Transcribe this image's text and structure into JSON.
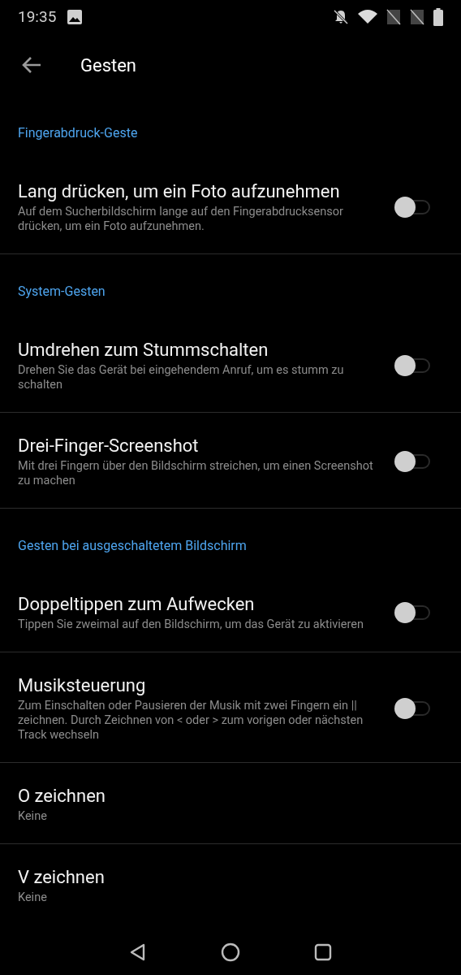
{
  "status_bar": {
    "time": "19:35"
  },
  "toolbar": {
    "title": "Gesten"
  },
  "sections": [
    {
      "heading": "Fingerabdruck-Geste",
      "items": [
        {
          "kind": "toggle",
          "title": "Lang drücken, um ein Foto aufzunehmen",
          "subtitle": "Auf dem Sucherbildschirm lange auf den Fingerabdrucksensor drücken, um ein Foto aufzunehmen.",
          "on": false
        }
      ]
    },
    {
      "heading": "System-Gesten",
      "items": [
        {
          "kind": "toggle",
          "title": "Umdrehen zum Stummschalten",
          "subtitle": "Drehen Sie das Gerät bei eingehendem Anruf, um es stumm zu schalten",
          "on": false
        },
        {
          "kind": "toggle",
          "title": "Drei-Finger-Screenshot",
          "subtitle": "Mit drei Fingern über den Bildschirm streichen, um einen Screenshot zu machen",
          "on": false
        }
      ]
    },
    {
      "heading": "Gesten bei ausgeschaltetem Bildschirm",
      "items": [
        {
          "kind": "toggle",
          "title": "Doppeltippen zum Aufwecken",
          "subtitle": "Tippen Sie zweimal auf den Bildschirm, um das Gerät zu aktivieren",
          "on": false
        },
        {
          "kind": "toggle",
          "title": "Musiksteuerung",
          "subtitle": "Zum Einschalten oder Pausieren der Musik mit zwei Fingern ein || zeichnen. Durch Zeichnen von < oder > zum vorigen oder nächsten Track wechseln",
          "on": false
        },
        {
          "kind": "value",
          "title": "O zeichnen",
          "subtitle": "Keine"
        },
        {
          "kind": "value",
          "title": "V zeichnen",
          "subtitle": "Keine"
        }
      ]
    }
  ]
}
